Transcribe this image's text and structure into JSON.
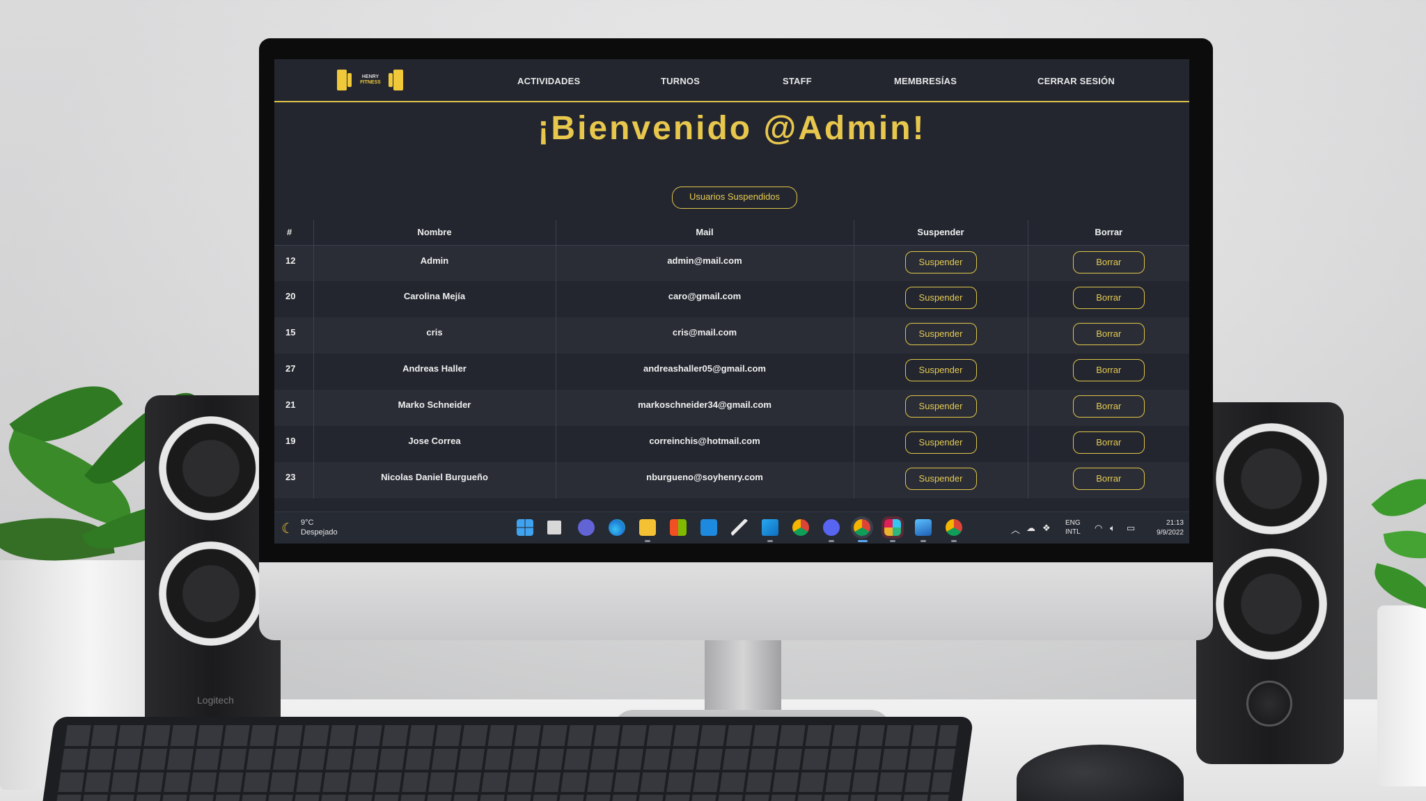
{
  "navbar": {
    "logo_line1": "HENRY",
    "logo_line2": "FITNESS",
    "links": [
      "ACTIVIDADES",
      "TURNOS",
      "STAFF",
      "MEMBRESÍAS",
      "CERRAR SESIÓN"
    ]
  },
  "welcome": "¡Bienvenido @Admin!",
  "suspended_button": "Usuarios Suspendidos",
  "table": {
    "headers": [
      "#",
      "Nombre",
      "Mail",
      "Suspender",
      "Borrar"
    ],
    "suspend_label": "Suspender",
    "delete_label": "Borrar",
    "rows": [
      {
        "id": "12",
        "name": "Admin",
        "mail": "admin@mail.com"
      },
      {
        "id": "20",
        "name": "Carolina Mejía",
        "mail": "caro@gmail.com"
      },
      {
        "id": "15",
        "name": "cris",
        "mail": "cris@mail.com"
      },
      {
        "id": "27",
        "name": "Andreas Haller",
        "mail": "andreashaller05@gmail.com"
      },
      {
        "id": "21",
        "name": "Marko Schneider",
        "mail": "markoschneider34@gmail.com"
      },
      {
        "id": "19",
        "name": "Jose Correa",
        "mail": "correinchis@hotmail.com"
      },
      {
        "id": "23",
        "name": "Nicolas Daniel Burgueño",
        "mail": "nburgueno@soyhenry.com"
      }
    ]
  },
  "taskbar": {
    "weather_temp": "9°C",
    "weather_desc": "Despejado",
    "lang_line1": "ENG",
    "lang_line2": "INTL",
    "time": "21:13",
    "date": "9/9/2022",
    "app_icons": [
      "windows-start-icon",
      "task-view-icon",
      "teams-chat-icon",
      "edge-icon",
      "file-explorer-icon",
      "store-icon",
      "mail-icon",
      "dev-tool-icon",
      "vscode-icon",
      "chrome-icon",
      "discord-icon",
      "chrome-profile-icon",
      "slack-icon",
      "photos-icon",
      "chrome-profile-2-icon"
    ]
  },
  "speaker_brand": "Logitech",
  "colors": {
    "accent": "#e0c64b",
    "background": "#23262f",
    "row_alt": "#2a2d36"
  }
}
